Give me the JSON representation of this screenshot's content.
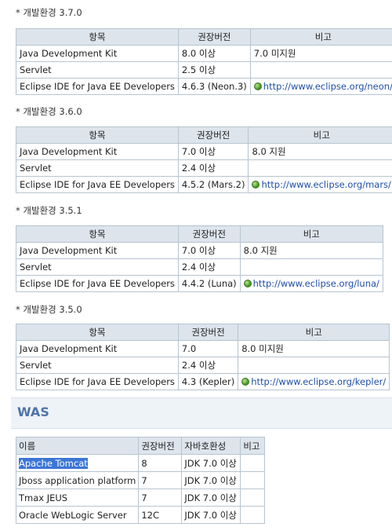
{
  "headers": {
    "item": "항목",
    "version": "권장버전",
    "note": "비고"
  },
  "envs": [
    {
      "title": "* 개발환경 3.7.0",
      "rows": [
        {
          "item": "Java Development Kit",
          "version": "8.0 이상",
          "note": "7.0 미지원"
        },
        {
          "item": "Servlet",
          "version": "2.5 이상",
          "note": ""
        },
        {
          "item": "Eclipse IDE for Java EE Developers",
          "version": "4.6.3 (Neon.3)",
          "link": "http://www.eclipse.org/neon/"
        }
      ]
    },
    {
      "title": "* 개발환경 3.6.0",
      "rows": [
        {
          "item": "Java Development Kit",
          "version": "7.0 이상",
          "note": "8.0 지원"
        },
        {
          "item": "Servlet",
          "version": "2.4 이상",
          "note": ""
        },
        {
          "item": "Eclipse IDE for Java EE Developers",
          "version": "4.5.2 (Mars.2)",
          "link": "http://www.eclipse.org/mars/"
        }
      ]
    },
    {
      "title": "* 개발환경 3.5.1",
      "rows": [
        {
          "item": "Java Development Kit",
          "version": "7.0 이상",
          "note": "8.0 지원"
        },
        {
          "item": "Servlet",
          "version": "2.4 이상",
          "note": ""
        },
        {
          "item": "Eclipse IDE for Java EE Developers",
          "version": "4.4.2 (Luna)",
          "link": "http://www.eclipse.org/luna/"
        }
      ]
    },
    {
      "title": "* 개발환경 3.5.0",
      "rows": [
        {
          "item": "Java Development Kit",
          "version": "7.0",
          "note": "8.0 미지원"
        },
        {
          "item": "Servlet",
          "version": "2.4 이상",
          "note": ""
        },
        {
          "item": "Eclipse IDE for Java EE Developers",
          "version": "4.3 (Kepler)",
          "link": "http://www.eclipse.org/kepler/"
        }
      ]
    }
  ],
  "was": {
    "title": "WAS",
    "headers": {
      "name": "이름",
      "version": "권장버전",
      "java": "자바호환성",
      "note": "비고"
    },
    "rows": [
      {
        "name": "Apache Tomcat",
        "version": "8",
        "java": "JDK 7.0 이상",
        "note": ""
      },
      {
        "name": "Jboss application platform",
        "version": "7",
        "java": "JDK 7.0 이상",
        "note": ""
      },
      {
        "name": "Tmax JEUS",
        "version": "7",
        "java": "JDK 7.0 이상",
        "note": ""
      },
      {
        "name": "Oracle WebLogic Server",
        "version": "12C",
        "java": "JDK 7.0 이상",
        "note": ""
      }
    ]
  }
}
